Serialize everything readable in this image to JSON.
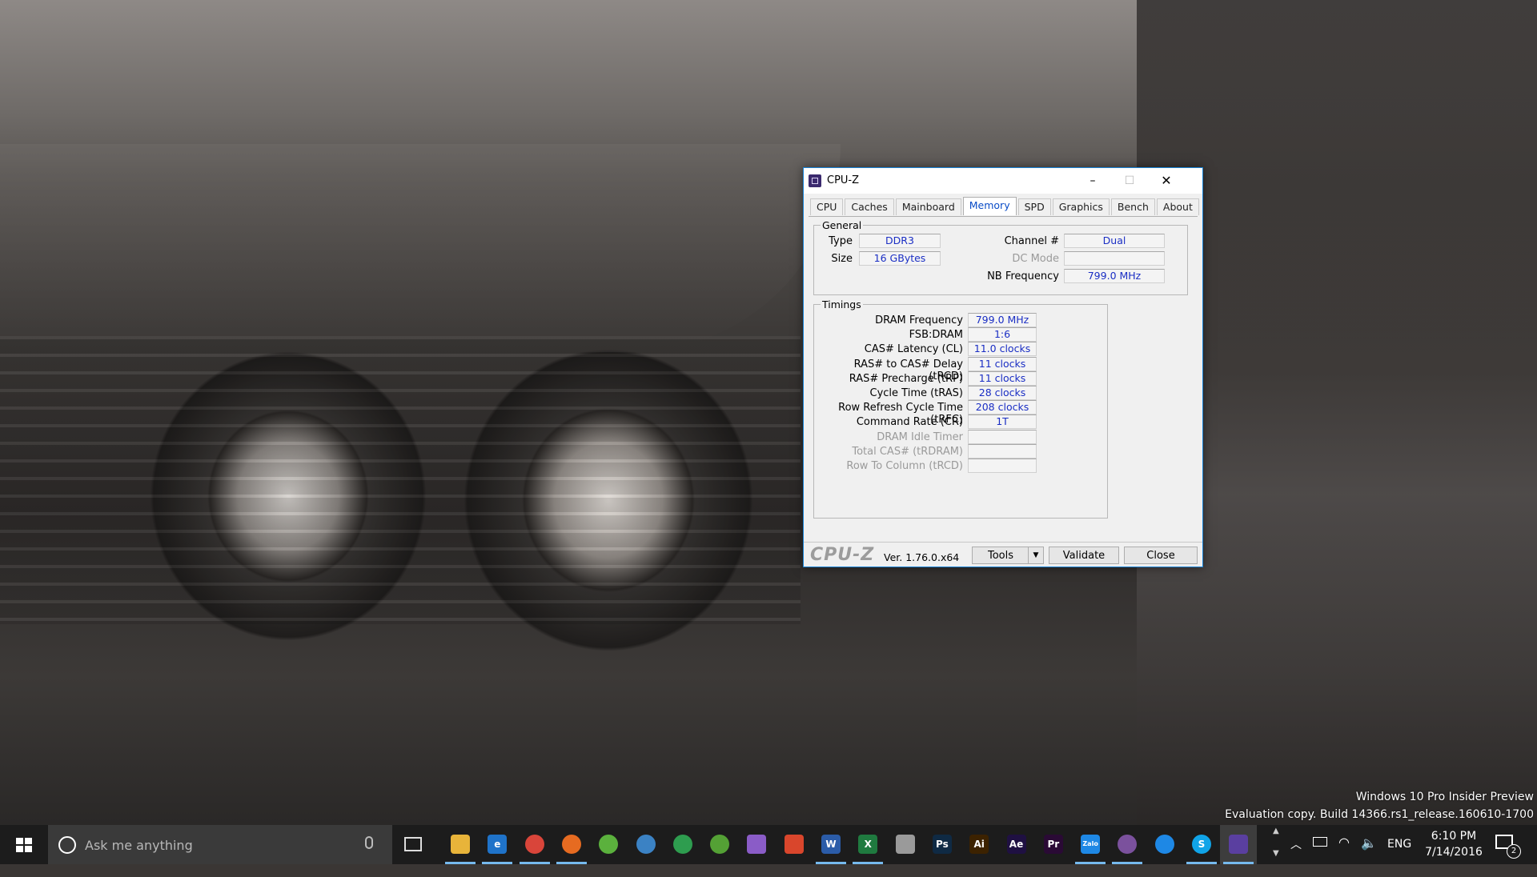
{
  "desktop": {
    "watermark_line1": "Windows 10 Pro Insider Preview",
    "watermark_line2": "Evaluation copy. Build 14366.rs1_release.160610-1700"
  },
  "window": {
    "title": "CPU-Z",
    "controls": {
      "minimize": "–",
      "maximize": "☐",
      "close": "✕"
    },
    "tabs": [
      "CPU",
      "Caches",
      "Mainboard",
      "Memory",
      "SPD",
      "Graphics",
      "Bench",
      "About"
    ],
    "active_tab": "Memory",
    "general": {
      "legend": "General",
      "type_label": "Type",
      "type_value": "DDR3",
      "size_label": "Size",
      "size_value": "16 GBytes",
      "channel_label": "Channel #",
      "channel_value": "Dual",
      "dc_mode_label": "DC Mode",
      "dc_mode_value": "",
      "nb_freq_label": "NB Frequency",
      "nb_freq_value": "799.0 MHz"
    },
    "timings": {
      "legend": "Timings",
      "rows": [
        {
          "label": "DRAM Frequency",
          "value": "799.0 MHz",
          "enabled": true
        },
        {
          "label": "FSB:DRAM",
          "value": "1:6",
          "enabled": true
        },
        {
          "label": "CAS# Latency (CL)",
          "value": "11.0 clocks",
          "enabled": true
        },
        {
          "label": "RAS# to CAS# Delay (tRCD)",
          "value": "11 clocks",
          "enabled": true
        },
        {
          "label": "RAS# Precharge (tRP)",
          "value": "11 clocks",
          "enabled": true
        },
        {
          "label": "Cycle Time (tRAS)",
          "value": "28 clocks",
          "enabled": true
        },
        {
          "label": "Row Refresh Cycle Time (tRFC)",
          "value": "208 clocks",
          "enabled": true
        },
        {
          "label": "Command Rate (CR)",
          "value": "1T",
          "enabled": true
        },
        {
          "label": "DRAM Idle Timer",
          "value": "",
          "enabled": false
        },
        {
          "label": "Total CAS# (tRDRAM)",
          "value": "",
          "enabled": false
        },
        {
          "label": "Row To Column (tRCD)",
          "value": "",
          "enabled": false
        }
      ]
    },
    "footer": {
      "brand": "CPU-Z",
      "version": "Ver. 1.76.0.x64",
      "tools_label": "Tools",
      "validate_label": "Validate",
      "close_label": "Close"
    }
  },
  "taskbar": {
    "search_placeholder": "Ask me anything",
    "apps": [
      {
        "name": "file-explorer",
        "glyph": "",
        "color": "#e8b43a",
        "running": true
      },
      {
        "name": "edge",
        "glyph": "e",
        "color": "#1f73c9",
        "running": true
      },
      {
        "name": "chrome",
        "glyph": "",
        "color": "#d9453a",
        "running": true
      },
      {
        "name": "firefox",
        "glyph": "",
        "color": "#e66b21",
        "running": true
      },
      {
        "name": "greenshot",
        "glyph": "",
        "color": "#5bb13d",
        "running": false
      },
      {
        "name": "app-blue-globe",
        "glyph": "",
        "color": "#3b82c4",
        "running": false
      },
      {
        "name": "app-color-wheel",
        "glyph": "",
        "color": "#2e9d4f",
        "running": false
      },
      {
        "name": "utorrent",
        "glyph": "",
        "color": "#54a135",
        "running": false
      },
      {
        "name": "visual-studio",
        "glyph": "",
        "color": "#8a5cc7",
        "running": false
      },
      {
        "name": "shield-app",
        "glyph": "",
        "color": "#d9462c",
        "running": false
      },
      {
        "name": "word",
        "glyph": "W",
        "color": "#2b5ca8",
        "running": true
      },
      {
        "name": "excel",
        "glyph": "X",
        "color": "#1f7a3f",
        "running": true
      },
      {
        "name": "phone-app",
        "glyph": "",
        "color": "#9a9a9a",
        "running": false
      },
      {
        "name": "photoshop",
        "glyph": "Ps",
        "color": "#0f2a44",
        "running": false
      },
      {
        "name": "illustrator",
        "glyph": "Ai",
        "color": "#3c2200",
        "running": false
      },
      {
        "name": "after-effects",
        "glyph": "Ae",
        "color": "#1f1042",
        "running": false
      },
      {
        "name": "premiere",
        "glyph": "Pr",
        "color": "#2a0a35",
        "running": false
      },
      {
        "name": "zalo",
        "glyph": "Zalo",
        "color": "#1e88e5",
        "running": true
      },
      {
        "name": "viber",
        "glyph": "",
        "color": "#7b519d",
        "running": true
      },
      {
        "name": "messenger",
        "glyph": "",
        "color": "#1e88e5",
        "running": false
      },
      {
        "name": "skype",
        "glyph": "S",
        "color": "#10a4e8",
        "running": true
      },
      {
        "name": "cpu-z",
        "glyph": "",
        "color": "#5a3fa0",
        "running": true,
        "active": true
      }
    ],
    "language": "ENG",
    "time": "6:10 PM",
    "date": "7/14/2016",
    "notification_count": "2"
  }
}
